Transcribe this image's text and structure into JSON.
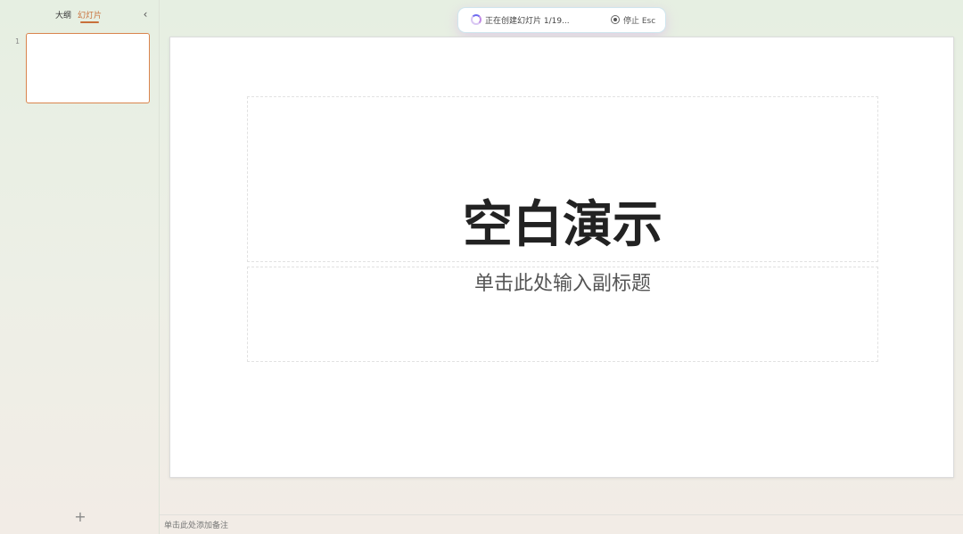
{
  "sidebar": {
    "tabs": [
      {
        "label": "大纲"
      },
      {
        "label": "幻灯片"
      }
    ],
    "active_tab": "幻灯片",
    "collapse_icon": "chevron-left-icon",
    "slides": [
      {
        "number": "1"
      }
    ],
    "add_icon": "plus-icon",
    "add_glyph": "+"
  },
  "status": {
    "text": "正在创建幻灯片 1/19...",
    "stop_label": "停止 Esc",
    "spinner_icon": "spinner-icon",
    "stop_icon": "stop-circle-icon"
  },
  "slide": {
    "title": "空白演示",
    "subtitle": "单击此处输入副标题"
  },
  "notes": {
    "placeholder": "单击此处添加备注"
  },
  "colors": {
    "accent": "#c8703a",
    "thumbnail_border": "#d9844d"
  }
}
